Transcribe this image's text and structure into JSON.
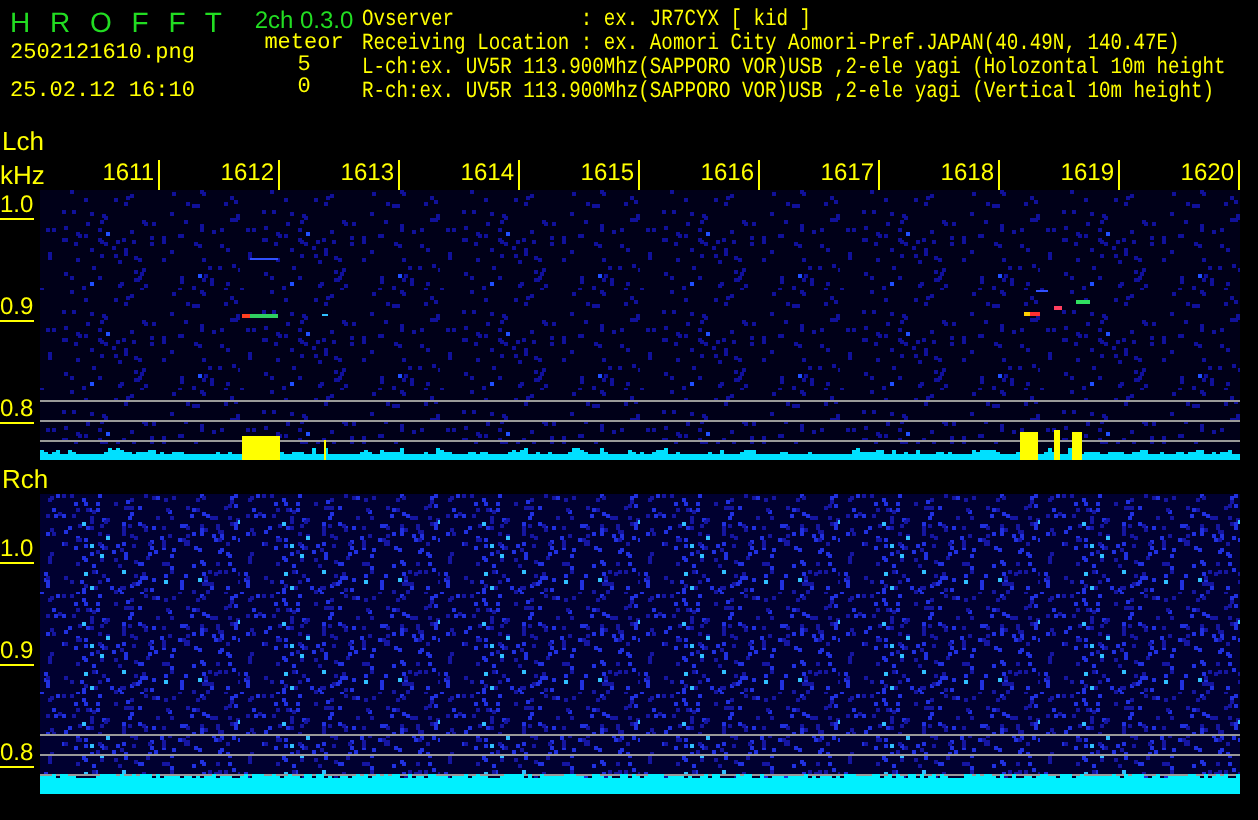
{
  "header": {
    "app_title": "H R O F F T",
    "filename": "2502121610.png",
    "timestamp": "25.02.12 16:10",
    "version": "2ch 0.3.0",
    "meteor_label": "meteor",
    "meteor_counts": [
      "5",
      "0"
    ],
    "info_lines": [
      "Ovserver           : ex. JR7CYX [ kid ]",
      "Receiving Location : ex. Aomori City Aomori-Pref.JAPAN(40.49N, 140.47E)",
      "L-ch:ex. UV5R 113.900Mhz(SAPPORO VOR)USB ,2-ele yagi (Holozontal 10m height",
      "R-ch:ex. UV5R 113.900Mhz(SAPPORO VOR)USB ,2-ele yagi (Vertical 10m height)"
    ]
  },
  "panels": [
    {
      "channel": "Lch",
      "unit": "kHz",
      "time_ticks": [
        "1611",
        "1612",
        "1613",
        "1614",
        "1615",
        "1616",
        "1617",
        "1618",
        "1619",
        "1620"
      ],
      "freq_ticks": [
        "1.0",
        "0.9",
        "0.8"
      ]
    },
    {
      "channel": "Rch",
      "freq_ticks": [
        "1.0",
        "0.9",
        "0.8"
      ]
    }
  ]
}
